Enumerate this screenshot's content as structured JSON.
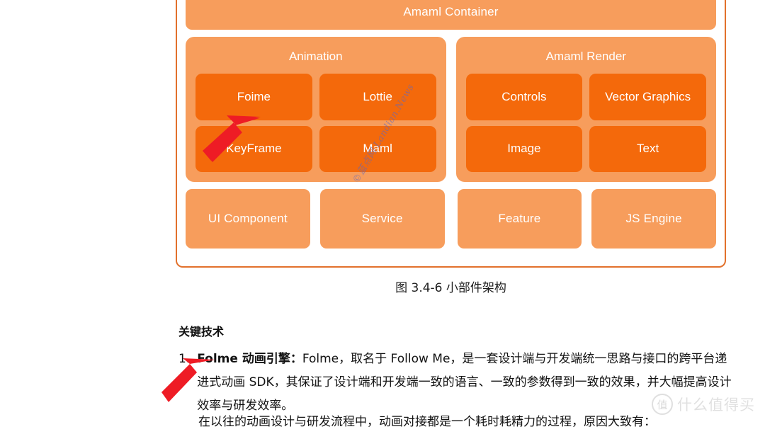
{
  "figure": {
    "container_band": "Amaml Container",
    "groups": [
      {
        "title": "Animation",
        "leaves": [
          "Foime",
          "Lottie",
          "KeyFrame",
          "Maml"
        ]
      },
      {
        "title": "Amaml Render",
        "leaves": [
          "Controls",
          "Vector Graphics",
          "Image",
          "Text"
        ]
      }
    ],
    "bottom_bands": [
      "UI Component",
      "Service",
      "Feature",
      "JS Engine"
    ],
    "caption": "图 3.4-6 小部件架构",
    "colors": {
      "panel": "#f79d5c",
      "leaf": "#f4690b",
      "border": "#e2712c",
      "label": "#ffffff",
      "arrow": "#ee1c25"
    }
  },
  "document": {
    "section_heading": "关键技术",
    "items": [
      {
        "number": "1.",
        "lead_term": "Folme 动画引擎：",
        "text": "Folme，取名于 Follow Me，是一套设计端与开发端统一思路与接口的跨平台递进式动画 SDK，其保证了设计端和开发端一致的语言、一致的参数得到一致的效果，并大幅提高设计效率与研发效率。"
      }
    ],
    "trailing_paragraph": "在以往的动画设计与研发流程中，动画对接都是一个耗时耗精力的过程，原因大致有："
  },
  "annotations": {
    "arrow_foime": "arrow pointing to Foime",
    "arrow_folme": "arrow pointing to Folme 动画引擎"
  },
  "watermarks": {
    "diagram": "©蓝点网 Landian.News",
    "page_badge": "值",
    "page_text": "什么值得买"
  }
}
